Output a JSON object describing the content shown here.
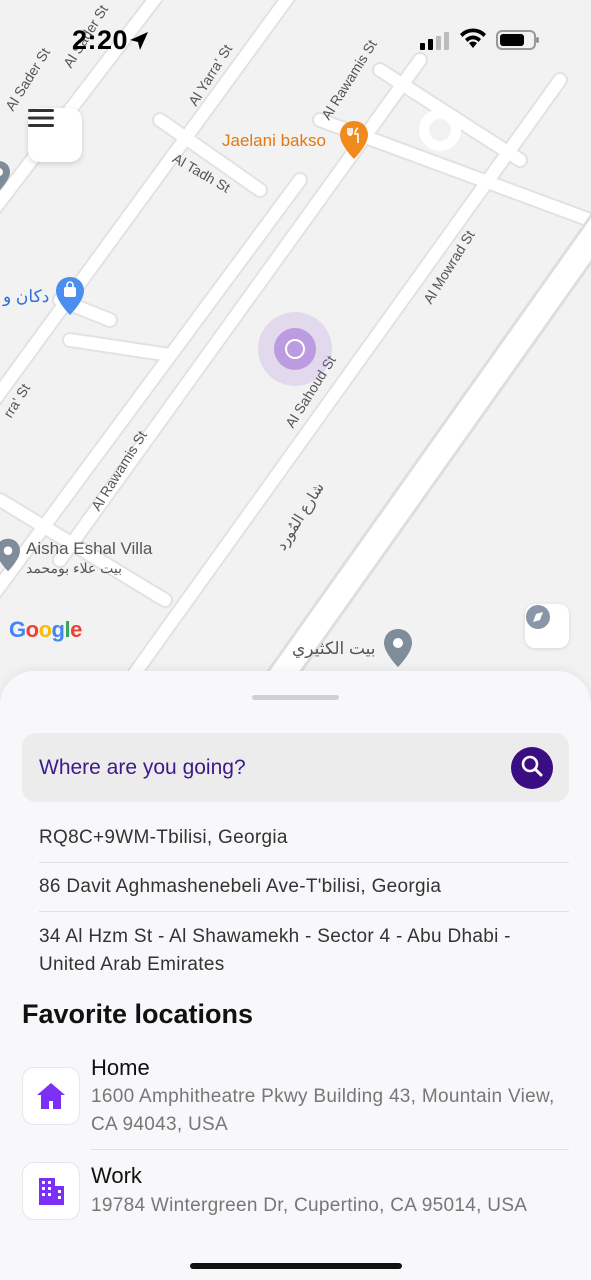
{
  "status_bar": {
    "time": "2:20"
  },
  "map": {
    "labels": {
      "al_sader_st": "Al Sader St",
      "al_sader_st2": "Al Sader St",
      "al_yarra_st": "Al Yarra' St",
      "al_rawamis_st_top": "Al Rawamis St",
      "al_tadh_st": "Al Tadh St",
      "al_mowrad_st": "Al Mowrad St",
      "al_sahoud_st": "Al Sahoud St",
      "al_rawamis_st": "Al Rawamis St",
      "arabic_street": "شارع المُورد",
      "yarra_partial": "rra' St",
      "jaelani_bakso": "Jaelani bakso",
      "shop_arabic": "دكان و",
      "aisha_villa": "Aisha Eshal Villa",
      "aisha_villa_arabic": "بيت علاء بومحمد",
      "bait_al_kathiri": "بيت الكثيري",
      "google": "Google"
    },
    "colors": {
      "road": "#ffffff",
      "land": "#f2f2f2",
      "poi_food": "#f08a1c",
      "poi_shop": "#4a8ff0",
      "poi_gray": "#7f8c99",
      "location": "#9b6ad6"
    }
  },
  "sheet": {
    "search_placeholder": "Where are you going?",
    "recent": [
      "RQ8C+9WM-Tbilisi, Georgia",
      "86 Davit Aghmashenebeli Ave-T'bilisi, Georgia",
      "34 Al Hzm St - Al Shawamekh - Sector 4 - Abu Dhabi - United Arab Emirates"
    ],
    "favorites_title": "Favorite locations",
    "favorites": [
      {
        "name": "Home",
        "address": "1600 Amphitheatre Pkwy Building 43, Mountain View, CA 94043, USA",
        "icon": "home-icon"
      },
      {
        "name": "Work",
        "address": "19784 Wintergreen Dr, Cupertino, CA 95014, USA",
        "icon": "building-icon"
      }
    ],
    "colors": {
      "accent": "#3b0d82",
      "icon_purple": "#7b2ff7"
    }
  }
}
